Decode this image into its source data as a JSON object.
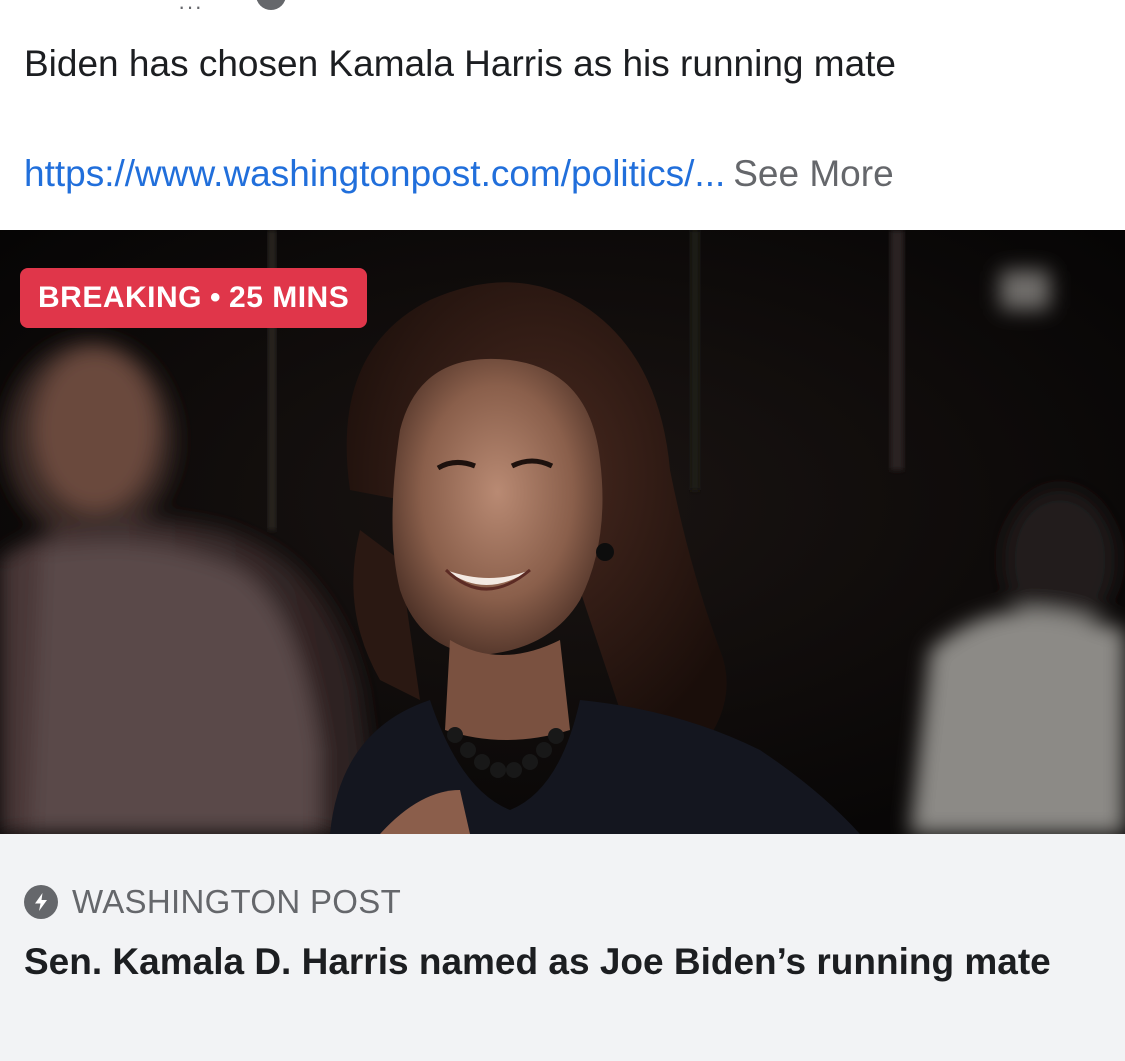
{
  "post": {
    "text": "Biden has chosen Kamala Harris as his running mate",
    "link_text": "https://www.washingtonpost.com/politics/...",
    "see_more": "See More"
  },
  "card": {
    "badge_label": "BREAKING",
    "badge_separator": "•",
    "badge_time": "25 MINS",
    "source": "WASHINGTON POST",
    "headline": "Sen. Kamala D. Harris named as Joe Biden’s running mate",
    "source_icon": "bolt-icon"
  },
  "colors": {
    "link": "#216fdb",
    "badge": "#e0364a",
    "muted": "#65676b",
    "card_footer": "#f2f3f5"
  }
}
